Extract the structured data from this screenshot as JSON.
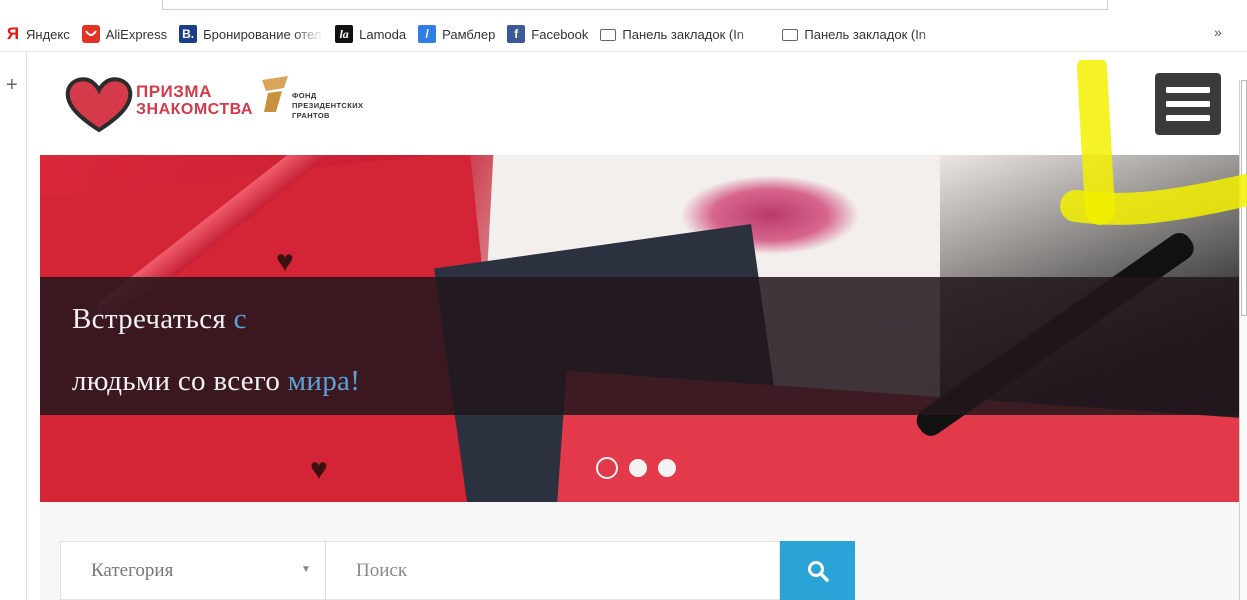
{
  "bookmarks": {
    "items": [
      {
        "label": "Яндекс",
        "icon": "yandex-icon"
      },
      {
        "label": "AliExpress",
        "icon": "aliexpress-icon"
      },
      {
        "label": "Бронирование отел",
        "icon": "booking-icon"
      },
      {
        "label": "Lamoda",
        "icon": "lamoda-icon"
      },
      {
        "label": "Рамблер",
        "icon": "rambler-icon"
      },
      {
        "label": "Facebook",
        "icon": "facebook-icon"
      },
      {
        "label": "Панель закладок (In",
        "icon": "folder-icon"
      },
      {
        "label": "Панель закладок (In",
        "icon": "folder-icon"
      }
    ],
    "overflow": "»",
    "icon_letters": {
      "yandex": "Я",
      "booking": "B.",
      "lamoda": "la",
      "rambler": "/",
      "facebook": "f"
    }
  },
  "sidebar": {
    "plus": "+"
  },
  "header": {
    "logo_line1": "ПРИЗМА",
    "logo_line2": "ЗНАКОМСТВА",
    "grant_line1": "ФОНД",
    "grant_line2": "ПРЕЗИДЕНТСКИХ",
    "grant_line3": "ГРАНТОВ",
    "brand_color": "#d43a4a"
  },
  "hero": {
    "line1": "Встречаться",
    "line1_accent": "с",
    "line2": "людьми со всего",
    "line2_accent": "мира!",
    "accent_color": "#5aa3d8",
    "slides_total": 3,
    "active_slide": 1
  },
  "search": {
    "category_label": "Категория",
    "search_placeholder": "Поиск",
    "button_color": "#2aa3d6"
  }
}
